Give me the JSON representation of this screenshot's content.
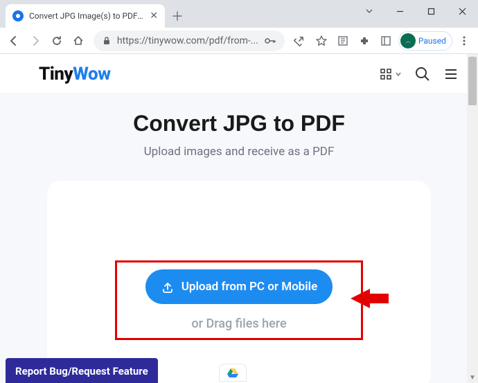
{
  "browser": {
    "tab_title": "Convert JPG Image(s) to PDF Onl",
    "url_display": "https://tinywow.com/pdf/from-...",
    "profile_status": "Paused"
  },
  "header": {
    "logo_part1": "Tiny",
    "logo_part2": "Wow"
  },
  "main": {
    "title": "Convert JPG to PDF",
    "subtitle": "Upload images and receive as a PDF",
    "upload_button": "Upload from PC or Mobile",
    "drag_text": "or Drag files here"
  },
  "footer": {
    "bug_button": "Report Bug/Request Feature"
  }
}
